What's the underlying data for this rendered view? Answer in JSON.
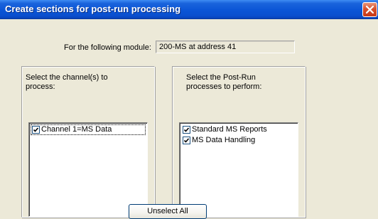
{
  "window": {
    "title": "Create sections for post-run processing"
  },
  "module": {
    "label": "For the following module:",
    "value": "200-MS at address 41"
  },
  "channels": {
    "caption": "Select the channel(s) to process:",
    "items": [
      {
        "label": "Channel 1=MS Data",
        "checked": true
      }
    ]
  },
  "processes": {
    "caption": "Select the Post-Run processes to perform:",
    "items": [
      {
        "label": "Standard MS Reports",
        "checked": true
      },
      {
        "label": "MS Data Handling",
        "checked": true
      }
    ]
  },
  "buttons": {
    "unselect_all": "Unselect All"
  },
  "icons": {
    "close": "close-icon",
    "check": "checkmark-icon"
  },
  "colors": {
    "titlebar": "#0b55d6",
    "dialog_bg": "#ece9d8",
    "close_button": "#d8502c"
  }
}
